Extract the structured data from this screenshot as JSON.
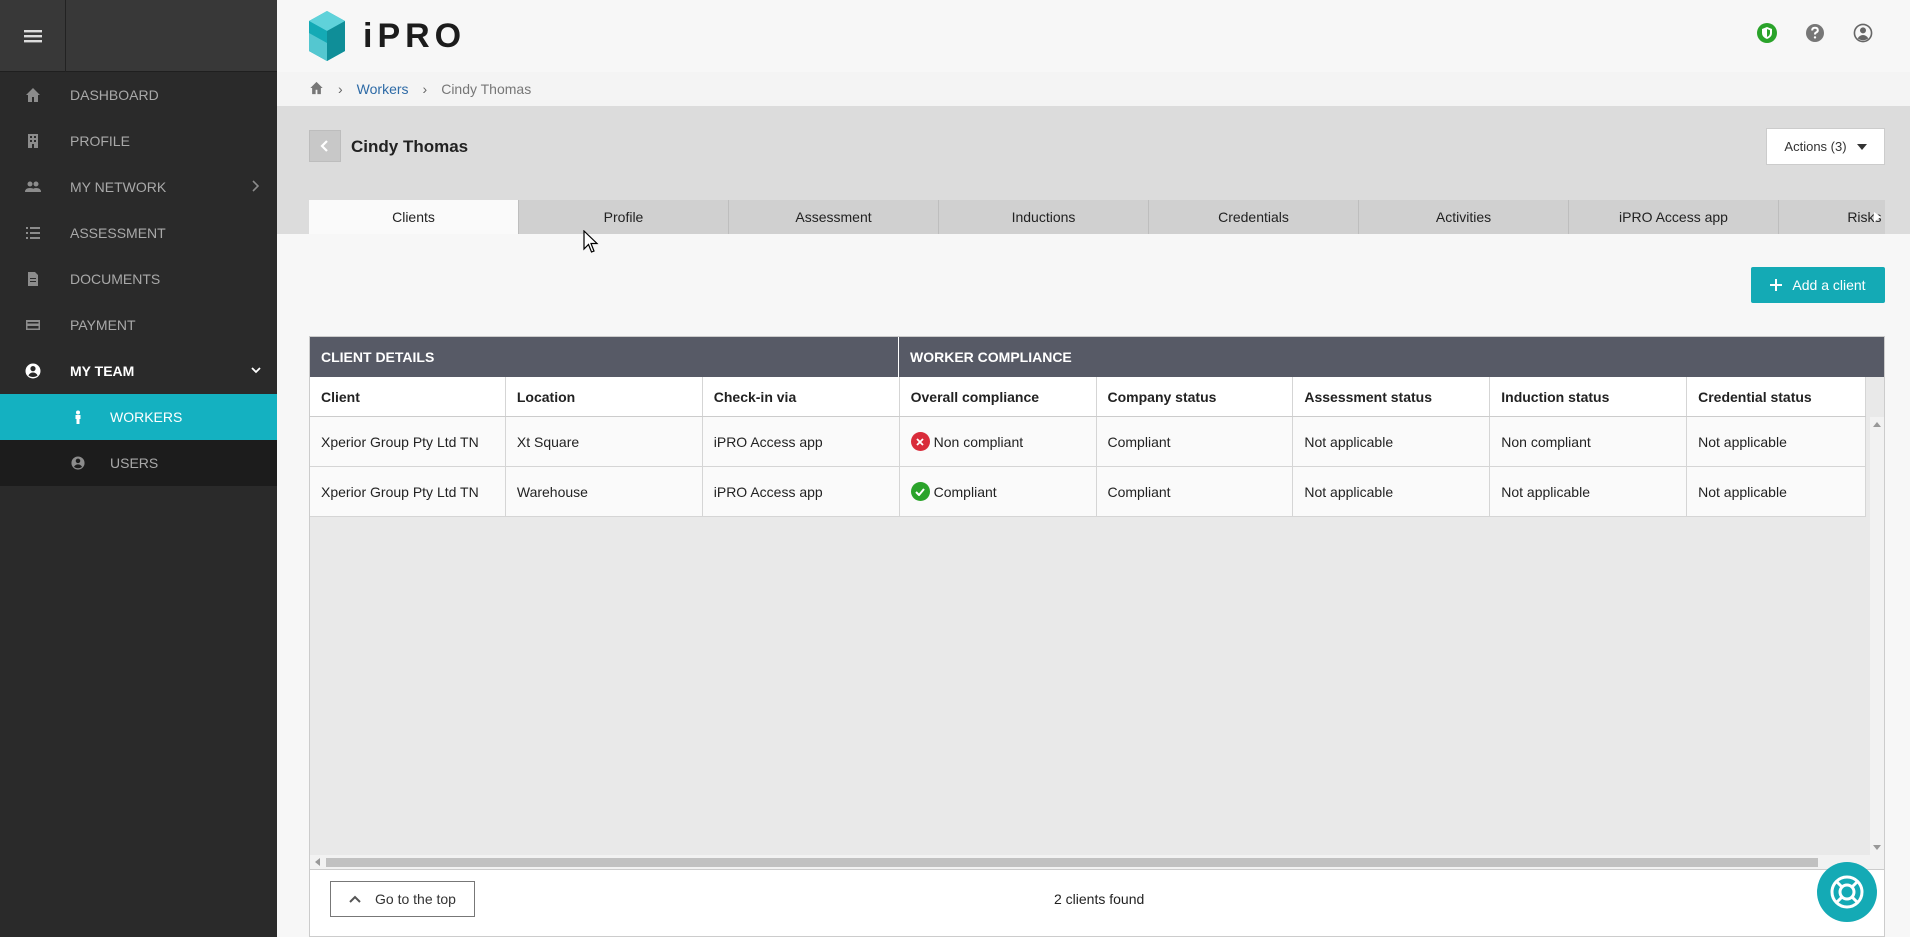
{
  "sidebar": {
    "items": [
      {
        "label": "DASHBOARD",
        "icon": "home-icon"
      },
      {
        "label": "PROFILE",
        "icon": "building-icon"
      },
      {
        "label": "MY NETWORK",
        "icon": "users-icon"
      },
      {
        "label": "ASSESSMENT",
        "icon": "list-icon"
      },
      {
        "label": "DOCUMENTS",
        "icon": "document-icon"
      },
      {
        "label": "PAYMENT",
        "icon": "credit-card-icon"
      },
      {
        "label": "MY TEAM",
        "icon": "user-circle-icon"
      }
    ],
    "sub_items": [
      {
        "label": "WORKERS",
        "icon": "person-icon"
      },
      {
        "label": "USERS",
        "icon": "user-circle-icon"
      }
    ]
  },
  "header": {
    "logo_text": "iPRO"
  },
  "breadcrumb": {
    "workers": "Workers",
    "current": "Cindy Thomas"
  },
  "page": {
    "worker_name": "Cindy Thomas",
    "actions_label": "Actions (3)"
  },
  "tabs": [
    "Clients",
    "Profile",
    "Assessment",
    "Inductions",
    "Credentials",
    "Activities",
    "iPRO Access app",
    "Risks and c"
  ],
  "content": {
    "add_client_label": "Add a client",
    "group_headers": [
      "CLIENT DETAILS",
      "WORKER COMPLIANCE"
    ],
    "columns": [
      "Client",
      "Location",
      "Check-in via",
      "Overall compliance",
      "Company status",
      "Assessment status",
      "Induction status",
      "Credential status"
    ],
    "rows": [
      [
        "Xperior Group Pty Ltd TN",
        "Xt Square",
        "iPRO Access app",
        "Non compliant",
        "Compliant",
        "Not applicable",
        "Non compliant",
        "Not applicable"
      ],
      [
        "Xperior Group Pty Ltd TN",
        "Warehouse",
        "iPRO Access app",
        "Compliant",
        "Compliant",
        "Not applicable",
        "Not applicable",
        "Not applicable"
      ]
    ],
    "go_top_label": "Go to the top",
    "clients_found": "2 clients found"
  },
  "colors": {
    "accent": "#14aab5",
    "sidebar_bg": "#2a2a2a",
    "table_header_bg": "#575a66",
    "non_compliant": "#d92b3a",
    "compliant": "#2aa32a"
  }
}
